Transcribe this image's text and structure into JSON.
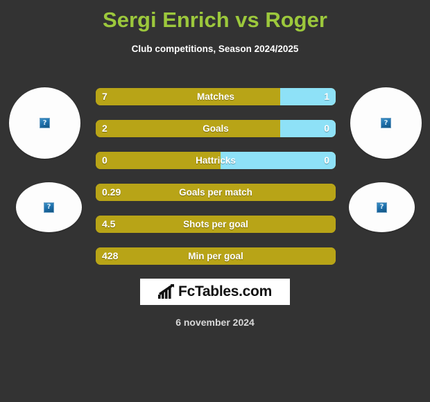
{
  "header": {
    "title": "Sergi Enrich vs Roger",
    "subtitle": "Club competitions, Season 2024/2025",
    "title_color": "#9cc83c"
  },
  "colors": {
    "background": "#333333",
    "bar_left": "#b8a417",
    "bar_right": "#8ee1f7",
    "text": "#ffffff"
  },
  "players": {
    "left": {
      "name": "Sergi Enrich",
      "photo_placeholder_icon": "broken-image-icon",
      "photo_placeholder_glyph": "?"
    },
    "right": {
      "name": "Roger",
      "photo_placeholder_icon": "broken-image-icon",
      "photo_placeholder_glyph": "?"
    }
  },
  "chart_data": {
    "type": "bar",
    "title": "Sergi Enrich vs Roger",
    "subtitle": "Club competitions, Season 2024/2025",
    "orientation": "horizontal-split",
    "legend": [
      "Sergi Enrich",
      "Roger"
    ],
    "categories": [
      "Matches",
      "Goals",
      "Hattricks",
      "Goals per match",
      "Shots per goal",
      "Min per goal"
    ],
    "series": [
      {
        "name": "Sergi Enrich",
        "values": [
          "7",
          "2",
          "0",
          "0.29",
          "4.5",
          "428"
        ]
      },
      {
        "name": "Roger",
        "values": [
          "1",
          "0",
          "0",
          "",
          "",
          ""
        ]
      }
    ],
    "left_fill_percent": [
      77,
      77,
      52,
      100,
      100,
      100
    ],
    "grid": false,
    "xlabel": "",
    "ylabel": ""
  },
  "rows": [
    {
      "label": "Matches",
      "left": "7",
      "right": "1",
      "left_pct": 77,
      "split": true
    },
    {
      "label": "Goals",
      "left": "2",
      "right": "0",
      "left_pct": 77,
      "split": true
    },
    {
      "label": "Hattricks",
      "left": "0",
      "right": "0",
      "left_pct": 52,
      "split": true
    },
    {
      "label": "Goals per match",
      "left": "0.29",
      "right": "",
      "left_pct": 100,
      "split": false
    },
    {
      "label": "Shots per goal",
      "left": "4.5",
      "right": "",
      "left_pct": 100,
      "split": false
    },
    {
      "label": "Min per goal",
      "left": "428",
      "right": "",
      "left_pct": 100,
      "split": false
    }
  ],
  "footer": {
    "logo_text": "FcTables.com",
    "logo_icon": "bar-chart-trend-icon",
    "date": "6 november 2024"
  }
}
